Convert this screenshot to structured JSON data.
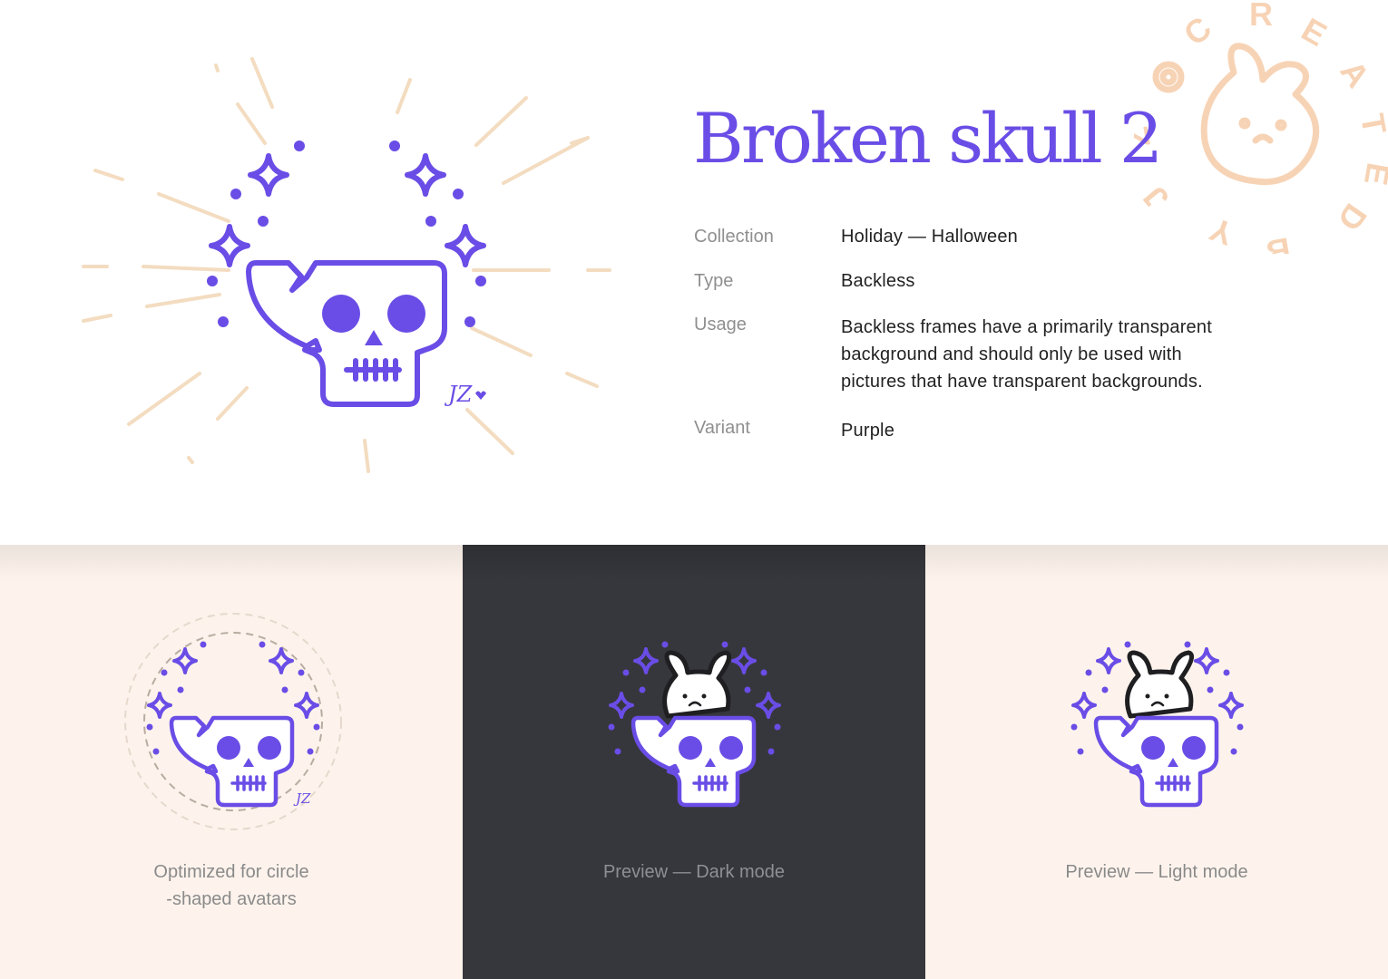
{
  "product": {
    "title": "Broken skull 2",
    "signature": "JZ"
  },
  "stamp": {
    "text": "@ CREATED BY JZ"
  },
  "details": [
    {
      "label": "Collection",
      "value": "Holiday — Halloween"
    },
    {
      "label": "Type",
      "value": "Backless"
    },
    {
      "label": "Usage",
      "value": "Backless frames have a primarily transparent background and should only be used with pictures that have transparent backgrounds."
    },
    {
      "label": "Variant",
      "value": "Purple"
    }
  ],
  "previews": [
    {
      "caption_line1": "Optimized for circle",
      "caption_line2": "-shaped avatars",
      "background": "#fdf3ec"
    },
    {
      "caption": "Preview — Dark mode",
      "background": "#36373c"
    },
    {
      "caption": "Preview — Light mode",
      "background": "#fdf3ec"
    }
  ],
  "colors": {
    "accent": "#6a4de6",
    "rays": "#f3dcc0",
    "stamp": "#f7d3b5"
  }
}
